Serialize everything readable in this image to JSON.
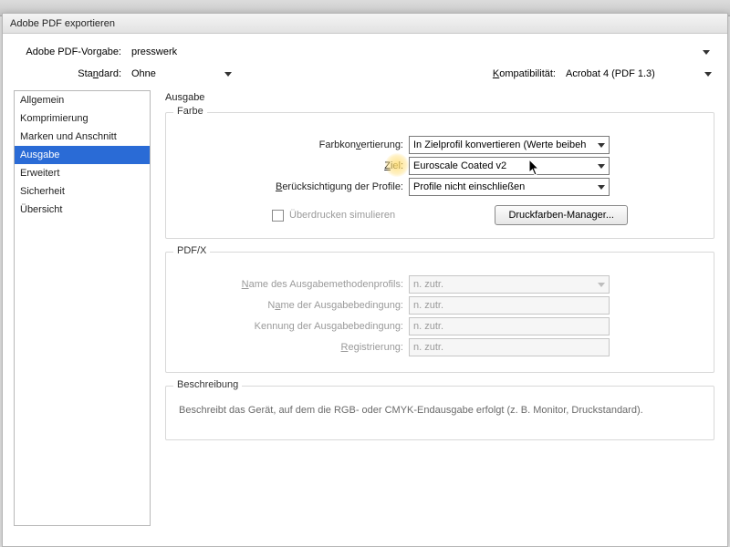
{
  "window": {
    "title": "Adobe PDF exportieren"
  },
  "top": {
    "preset_label": "Adobe PDF-Vorgabe:",
    "preset_value": "presswerk",
    "standard_label_pre": "Sta",
    "standard_label_ul": "n",
    "standard_label_post": "dard:",
    "standard_value": "Ohne",
    "compat_label_ul": "K",
    "compat_label_post": "ompatibilität:",
    "compat_value": "Acrobat 4 (PDF 1.3)"
  },
  "sidebar": {
    "items": [
      {
        "label": "Allgemein"
      },
      {
        "label": "Komprimierung"
      },
      {
        "label": "Marken und Anschnitt"
      },
      {
        "label": "Ausgabe"
      },
      {
        "label": "Erweitert"
      },
      {
        "label": "Sicherheit"
      },
      {
        "label": "Übersicht"
      }
    ],
    "selected_index": 3
  },
  "main": {
    "title": "Ausgabe",
    "farbe": {
      "legend": "Farbe",
      "conv_label_pre": "Farbkon",
      "conv_label_ul": "v",
      "conv_label_post": "ertierung:",
      "conv_value": "In Zielprofil konvertieren (Werte beibeh",
      "ziel_label_ul": "Z",
      "ziel_label_post": "iel:",
      "ziel_value": "Euroscale Coated v2",
      "profile_label_pre": "",
      "profile_label_ul": "B",
      "profile_label_post": "erücksichtigung der Profile:",
      "profile_value": "Profile nicht einschließen",
      "overprint_label": "Überdrucken simulieren",
      "inkmgr_label": "Druckfarben-Manager..."
    },
    "pdfx": {
      "legend": "PDF/X",
      "rows": {
        "r1_pre": "",
        "r1_ul": "N",
        "r1_post": "ame des Ausgabemethodenprofils:",
        "r2_pre": "N",
        "r2_ul": "a",
        "r2_post": "me der Ausgabebedingung:",
        "r3_pre": "Kennun",
        "r3_ul": "g",
        "r3_post": " der Ausgabebedingung:",
        "r4_pre": "",
        "r4_ul": "R",
        "r4_post": "egistrierung:"
      },
      "na": "n. zutr."
    },
    "desc": {
      "legend": "Beschreibung",
      "text": "Beschreibt das Gerät, auf dem die RGB- oder CMYK-Endausgabe erfolgt (z. B. Monitor, Druckstandard)."
    }
  }
}
